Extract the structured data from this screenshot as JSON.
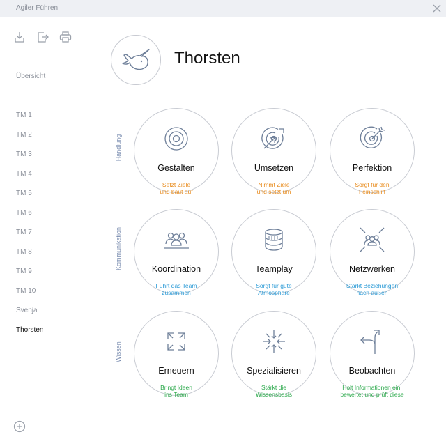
{
  "window": {
    "title": "Agiler Führen"
  },
  "toolbar": {
    "icons": [
      "download-icon",
      "export-icon",
      "print-icon"
    ]
  },
  "sidebar": {
    "overview": "Übersicht",
    "items": [
      "TM 1",
      "TM 2",
      "TM 3",
      "TM 4",
      "TM 5",
      "TM 6",
      "TM 7",
      "TM 8",
      "TM 9",
      "TM 10",
      "Svenja",
      "Thorsten"
    ],
    "active": "Thorsten"
  },
  "profile": {
    "name": "Thorsten",
    "avatar_icon": "narwhal-icon"
  },
  "rows": [
    {
      "label": "Handlung",
      "color": "#e88a1a",
      "cards": [
        {
          "title": "Gestalten",
          "desc": [
            "Setzt Ziele",
            "und baut auf"
          ],
          "icon": "target-icon"
        },
        {
          "title": "Umsetzen",
          "desc": [
            "Nimmt Ziele",
            "und setzt um"
          ],
          "icon": "target-arrow-icon"
        },
        {
          "title": "Perfektion",
          "desc": [
            "Sorgt für den",
            "Feinschliff"
          ],
          "icon": "target-dart-icon"
        }
      ]
    },
    {
      "label": "Kommunikation",
      "color": "#2a9ad6",
      "cards": [
        {
          "title": "Koordination",
          "desc": [
            "Führt das Team",
            "zusammen"
          ],
          "icon": "team-icon"
        },
        {
          "title": "Teamplay",
          "desc": [
            "Sorgt für gute",
            "Atmosphäre"
          ],
          "icon": "stack-icon"
        },
        {
          "title": "Netzwerken",
          "desc": [
            "Stärkt Beziehungen",
            "nach außen"
          ],
          "icon": "network-icon"
        }
      ]
    },
    {
      "label": "Wissen",
      "color": "#2aa84a",
      "cards": [
        {
          "title": "Erneuern",
          "desc": [
            "Bringt Ideen",
            "ins Team"
          ],
          "icon": "expand-icon"
        },
        {
          "title": "Spezialisieren",
          "desc": [
            "Stärkt die",
            "Wissensbasis"
          ],
          "icon": "converge-icon"
        },
        {
          "title": "Beobachten",
          "desc": [
            "Holt Informationen ein,",
            "bewertet und prüft diese"
          ],
          "icon": "fork-arrow-icon"
        }
      ]
    }
  ]
}
